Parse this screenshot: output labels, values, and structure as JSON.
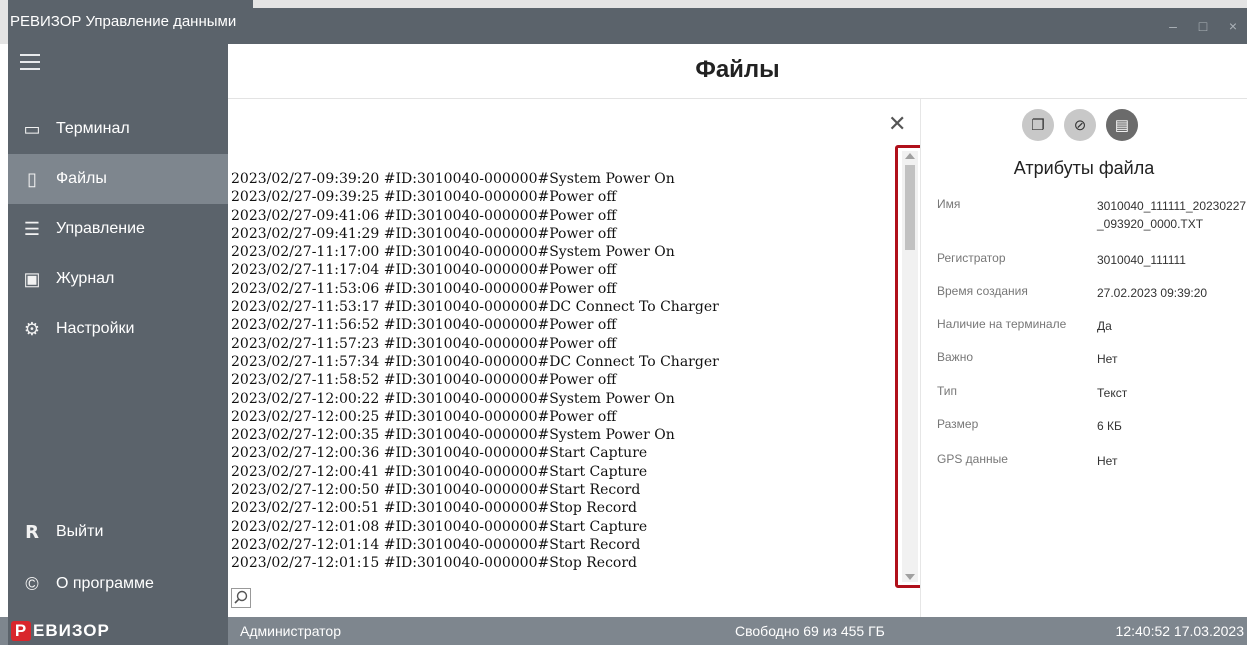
{
  "window": {
    "title": "РЕВИЗОР Управление данными",
    "controls": [
      "–",
      "□",
      "×"
    ]
  },
  "sidebar": {
    "items": [
      {
        "label": "Терминал",
        "icon": "terminal-icon"
      },
      {
        "label": "Файлы",
        "icon": "file-icon"
      },
      {
        "label": "Управление",
        "icon": "sliders-icon"
      },
      {
        "label": "Журнал",
        "icon": "journal-icon"
      },
      {
        "label": "Настройки",
        "icon": "gear-icon"
      },
      {
        "label": "Выйти",
        "icon": "user-icon"
      },
      {
        "label": "О программе",
        "icon": "copyright-icon"
      }
    ],
    "active": "Файлы"
  },
  "header": {
    "title": "Файлы"
  },
  "log": {
    "lines": [
      "2023/02/27-09:39:20 #ID:3010040-000000#System Power On",
      "2023/02/27-09:39:25 #ID:3010040-000000#Power off",
      "2023/02/27-09:41:06 #ID:3010040-000000#Power off",
      "2023/02/27-09:41:29 #ID:3010040-000000#Power off",
      "2023/02/27-11:17:00 #ID:3010040-000000#System Power On",
      "2023/02/27-11:17:04 #ID:3010040-000000#Power off",
      "2023/02/27-11:53:06 #ID:3010040-000000#Power off",
      "2023/02/27-11:53:17 #ID:3010040-000000#DC Connect To Charger",
      "2023/02/27-11:56:52 #ID:3010040-000000#Power off",
      "2023/02/27-11:57:23 #ID:3010040-000000#Power off",
      "2023/02/27-11:57:34 #ID:3010040-000000#DC Connect To Charger",
      "2023/02/27-11:58:52 #ID:3010040-000000#Power off",
      "2023/02/27-12:00:22 #ID:3010040-000000#System Power On",
      "2023/02/27-12:00:25 #ID:3010040-000000#Power off",
      "2023/02/27-12:00:35 #ID:3010040-000000#System Power On",
      "2023/02/27-12:00:36 #ID:3010040-000000#Start Capture",
      "2023/02/27-12:00:41 #ID:3010040-000000#Start Capture",
      "2023/02/27-12:00:50 #ID:3010040-000000#Start Record",
      "2023/02/27-12:00:51 #ID:3010040-000000#Stop Record",
      "2023/02/27-12:01:08 #ID:3010040-000000#Start Capture",
      "2023/02/27-12:01:14 #ID:3010040-000000#Start Record",
      "2023/02/27-12:01:15 #ID:3010040-000000#Stop Record"
    ]
  },
  "panel": {
    "title": "Атрибуты файла",
    "buttons": [
      "copy-icon",
      "tag-icon",
      "export-icon"
    ],
    "attributes": [
      {
        "label": "Имя",
        "value": "3010040_111111_20230227_093920_0000.TXT"
      },
      {
        "label": "Регистратор",
        "value": "3010040_111111"
      },
      {
        "label": "Время создания",
        "value": "27.02.2023 09:39:20"
      },
      {
        "label": "Наличие на терминале",
        "value": "Да"
      },
      {
        "label": "Важно",
        "value": "Нет"
      },
      {
        "label": "Тип",
        "value": "Текст"
      },
      {
        "label": "Размер",
        "value": "6 КБ"
      },
      {
        "label": "GPS данные",
        "value": "Нет"
      }
    ]
  },
  "status": {
    "brand_letter": "Р",
    "brand_rest": "ЕВИЗОР",
    "user": "Администратор",
    "free_space": "Свободно 69 из 455 ГБ",
    "datetime": "12:40:52 17.03.2023"
  },
  "colors": {
    "sidebar": "#5b636b",
    "sidebar_active": "#7e868e",
    "highlight": "#b0101b",
    "brand_red": "#d9262c"
  }
}
